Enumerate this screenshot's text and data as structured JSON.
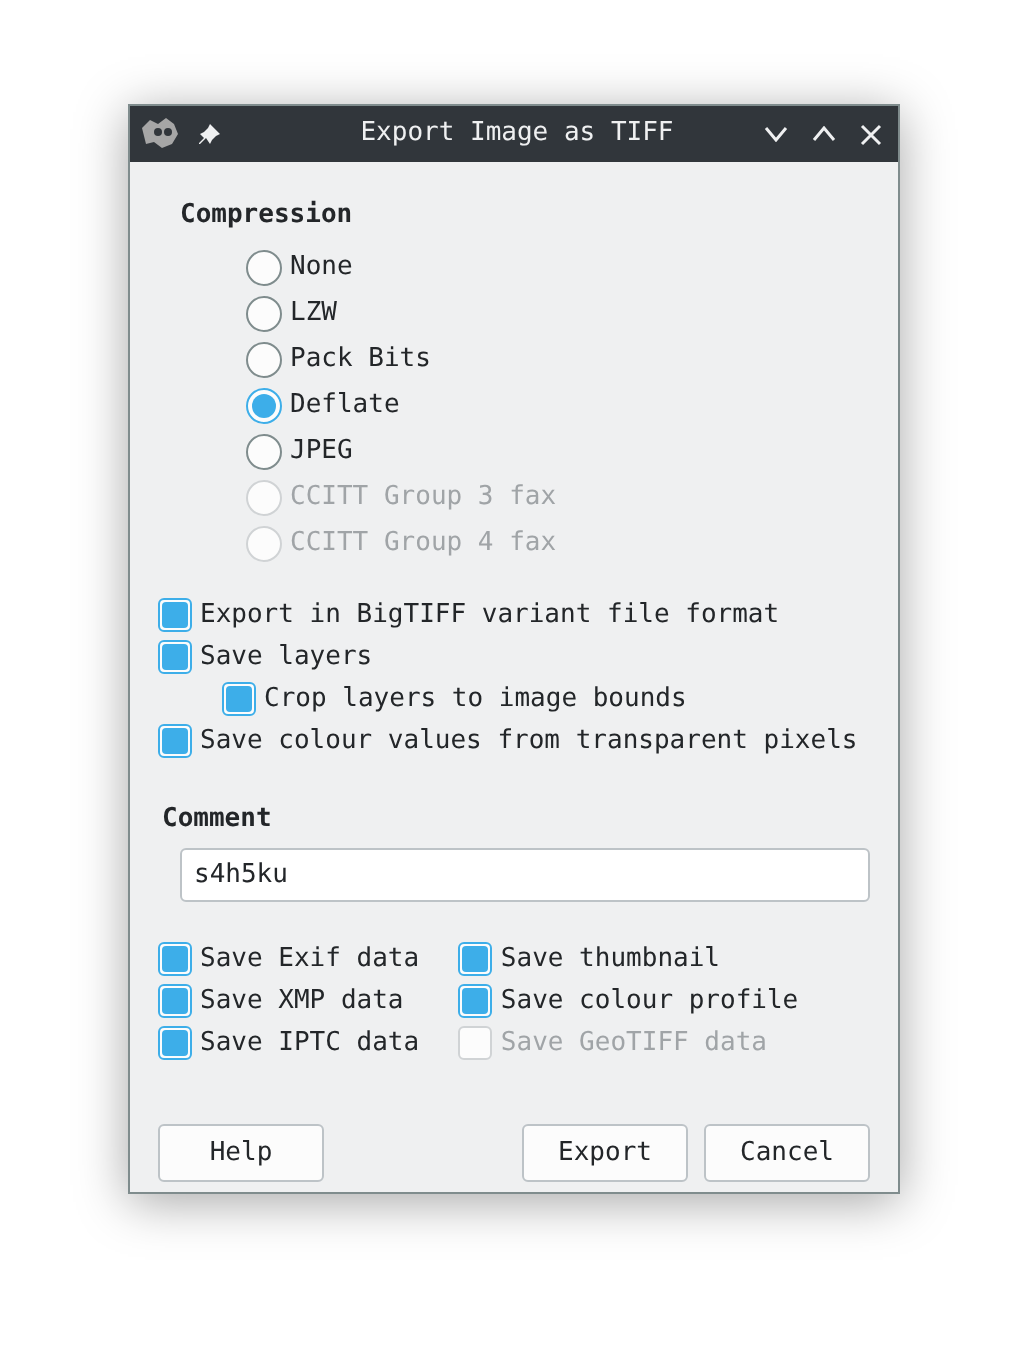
{
  "window": {
    "title": "Export Image as TIFF"
  },
  "compression": {
    "label": "Compression",
    "options": [
      {
        "label": "None",
        "selected": false,
        "disabled": false
      },
      {
        "label": "LZW",
        "selected": false,
        "disabled": false
      },
      {
        "label": "Pack Bits",
        "selected": false,
        "disabled": false
      },
      {
        "label": "Deflate",
        "selected": true,
        "disabled": false
      },
      {
        "label": "JPEG",
        "selected": false,
        "disabled": false
      },
      {
        "label": "CCITT Group 3 fax",
        "selected": false,
        "disabled": true
      },
      {
        "label": "CCITT Group 4 fax",
        "selected": false,
        "disabled": true
      }
    ]
  },
  "options": [
    {
      "label": "Export in BigTIFF variant file format",
      "checked": true,
      "disabled": false
    },
    {
      "label": "Save layers",
      "checked": true,
      "disabled": false,
      "children": [
        {
          "label": "Crop layers to image bounds",
          "checked": true,
          "disabled": false
        }
      ]
    },
    {
      "label": "Save colour values from transparent pixels",
      "checked": true,
      "disabled": false
    }
  ],
  "comment": {
    "label": "Comment",
    "value": "s4h5ku"
  },
  "metadata": [
    {
      "label": "Save Exif data",
      "checked": true,
      "disabled": false
    },
    {
      "label": "Save XMP data",
      "checked": true,
      "disabled": false
    },
    {
      "label": "Save IPTC data",
      "checked": true,
      "disabled": false
    },
    {
      "label": "Save thumbnail",
      "checked": true,
      "disabled": false
    },
    {
      "label": "Save colour profile",
      "checked": true,
      "disabled": false
    },
    {
      "label": "Save GeoTIFF data",
      "checked": false,
      "disabled": true
    }
  ],
  "buttons": {
    "left": [
      "Help"
    ],
    "right": [
      "Export",
      "Cancel"
    ]
  }
}
